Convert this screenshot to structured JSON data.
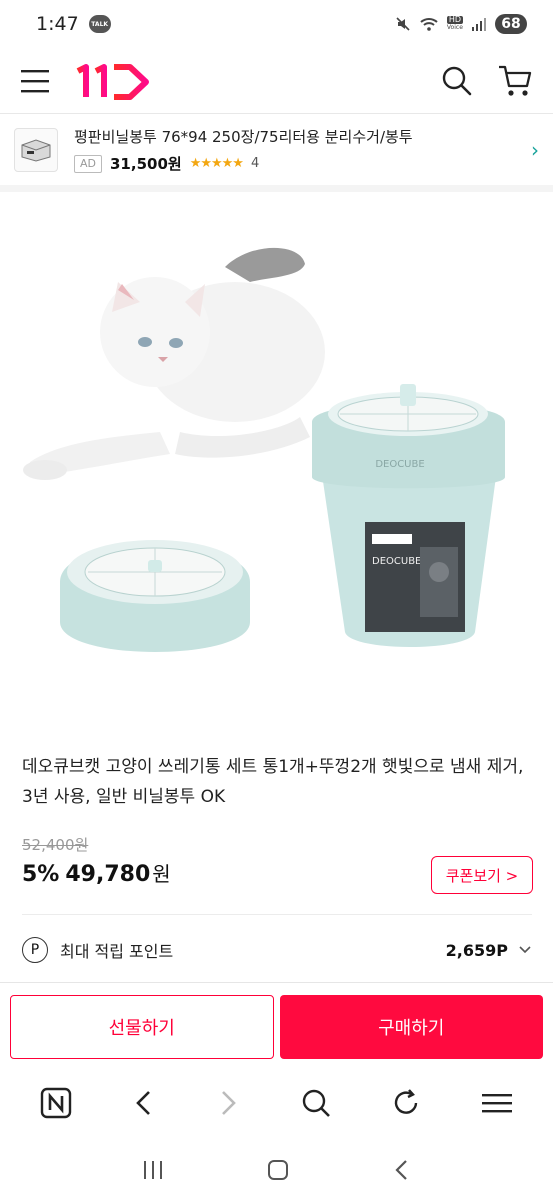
{
  "status": {
    "time": "1:47",
    "talk_label": "TALK",
    "battery": "68",
    "hd_label": "HD",
    "voice_label": "Voice"
  },
  "header": {
    "logo": "11번가",
    "icons": [
      "menu-icon",
      "search-icon",
      "cart-icon"
    ]
  },
  "ad": {
    "title": "평판비닐봉투 76*94 250장/75리터용 분리수거/봉투",
    "badge": "AD",
    "price": "31,500원",
    "stars": "★★★★★",
    "rating_value": 4.5,
    "review_count": "4"
  },
  "product": {
    "title": "데오큐브캣 고양이 쓰레기통 세트 통1개+뚜껑2개 햇빛으로 냄새 제거, 3년 사용, 일반 비닐봉투 OK",
    "original_price": "52,400원",
    "discount": "5%",
    "sale_price": "49,780",
    "sale_unit": "원",
    "coupon_label": "쿠폰보기 >",
    "image_brand": "DEOCUBE"
  },
  "points": {
    "icon_letter": "P",
    "label": "최대 적립 포인트",
    "value": "2,659P"
  },
  "actions": {
    "gift_label": "선물하기",
    "buy_label": "구매하기"
  },
  "colors": {
    "accent": "#ff0038",
    "teal": "#19a39b",
    "bin": "#c9e4e2"
  }
}
